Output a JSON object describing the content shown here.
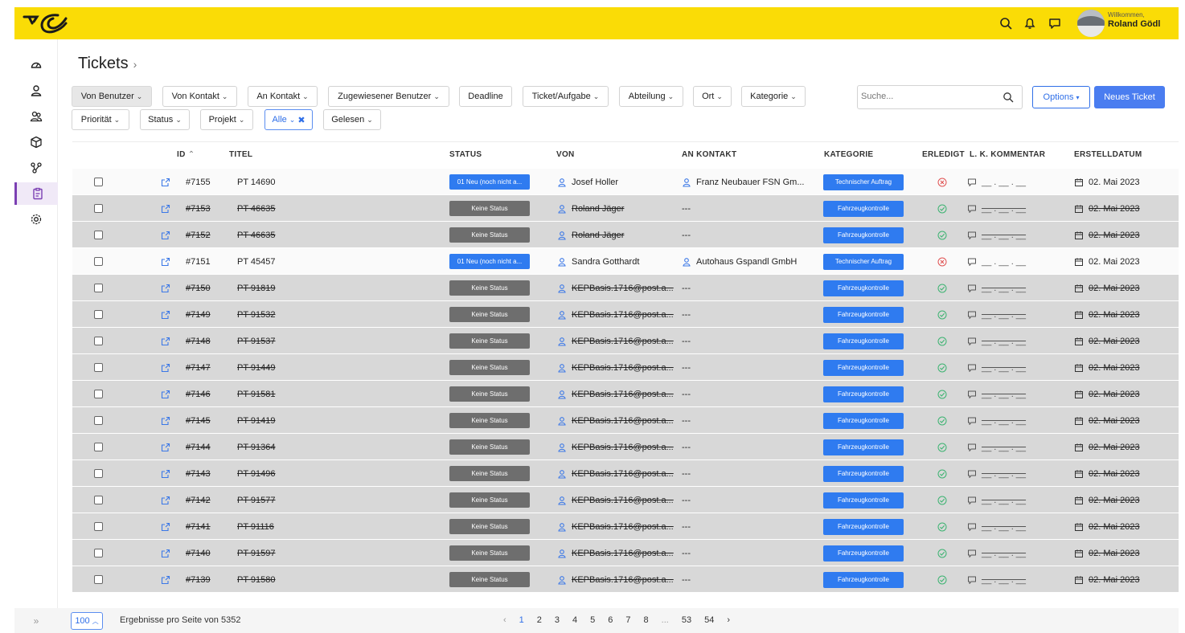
{
  "header": {
    "welcome": "Willkommen,",
    "user_name": "Roland Gödl",
    "brand_color": "#fadc06"
  },
  "page": {
    "title": "Tickets",
    "breadcrumb_chevron": "›"
  },
  "filters": {
    "row1": [
      "Von Benutzer",
      "Von Kontakt",
      "An Kontakt",
      "Zugewiesener Benutzer",
      "Deadline",
      "Ticket/Aufgabe",
      "Abteilung",
      "Ort",
      "Kategorie"
    ],
    "row2": [
      "Priorität",
      "Status",
      "Projekt",
      "Alle",
      "Gelesen"
    ]
  },
  "search": {
    "placeholder": "Suche..."
  },
  "buttons": {
    "options": "Options",
    "new_ticket": "Neues Ticket"
  },
  "columns": {
    "id": "ID",
    "titel": "TITEL",
    "status": "STATUS",
    "von": "VON",
    "an_kontakt": "AN KONTAKT",
    "kategorie": "KATEGORIE",
    "erledigt": "ERLEDIGT",
    "kommentar": "L. K. KOMMENTAR",
    "erstelldatum": "ERSTELLDATUM"
  },
  "tickets": [
    {
      "id": "#7155",
      "titel": "PT 14690",
      "status": "01 Neu (noch nicht a...",
      "von": "Josef Holler",
      "an_kontakt": "Franz Neubauer FSN Gm...",
      "kategorie": "Technischer Auftrag",
      "erledigt": false,
      "kommentar": "__ . __ . __",
      "datum": "02. Mai 2023",
      "closed": false
    },
    {
      "id": "#7153",
      "titel": "PT 46635",
      "status": "Keine Status",
      "von": "Roland Jäger",
      "an_kontakt": "---",
      "kategorie": "Fahrzeugkontrolle",
      "erledigt": true,
      "kommentar": "__ . __ . __",
      "datum": "02. Mai 2023",
      "closed": true
    },
    {
      "id": "#7152",
      "titel": "PT 46635",
      "status": "Keine Status",
      "von": "Roland Jäger",
      "an_kontakt": "---",
      "kategorie": "Fahrzeugkontrolle",
      "erledigt": true,
      "kommentar": "__ . __ . __",
      "datum": "02. Mai 2023",
      "closed": true
    },
    {
      "id": "#7151",
      "titel": "PT 45457",
      "status": "01 Neu (noch nicht a...",
      "von": "Sandra Gotthardt",
      "an_kontakt": "Autohaus Gspandl GmbH",
      "kategorie": "Technischer Auftrag",
      "erledigt": false,
      "kommentar": "__ . __ . __",
      "datum": "02. Mai 2023",
      "closed": false
    },
    {
      "id": "#7150",
      "titel": "PT 91819",
      "status": "Keine Status",
      "von": "KEPBasis.1716@post.a...",
      "an_kontakt": "---",
      "kategorie": "Fahrzeugkontrolle",
      "erledigt": true,
      "kommentar": "__ . __ . __",
      "datum": "02. Mai 2023",
      "closed": true
    },
    {
      "id": "#7149",
      "titel": "PT 91532",
      "status": "Keine Status",
      "von": "KEPBasis.1716@post.a...",
      "an_kontakt": "---",
      "kategorie": "Fahrzeugkontrolle",
      "erledigt": true,
      "kommentar": "__ . __ . __",
      "datum": "02. Mai 2023",
      "closed": true
    },
    {
      "id": "#7148",
      "titel": "PT 91537",
      "status": "Keine Status",
      "von": "KEPBasis.1716@post.a...",
      "an_kontakt": "---",
      "kategorie": "Fahrzeugkontrolle",
      "erledigt": true,
      "kommentar": "__ . __ . __",
      "datum": "02. Mai 2023",
      "closed": true
    },
    {
      "id": "#7147",
      "titel": "PT 91449",
      "status": "Keine Status",
      "von": "KEPBasis.1716@post.a...",
      "an_kontakt": "---",
      "kategorie": "Fahrzeugkontrolle",
      "erledigt": true,
      "kommentar": "__ . __ . __",
      "datum": "02. Mai 2023",
      "closed": true
    },
    {
      "id": "#7146",
      "titel": "PT 91581",
      "status": "Keine Status",
      "von": "KEPBasis.1716@post.a...",
      "an_kontakt": "---",
      "kategorie": "Fahrzeugkontrolle",
      "erledigt": true,
      "kommentar": "__ . __ . __",
      "datum": "02. Mai 2023",
      "closed": true
    },
    {
      "id": "#7145",
      "titel": "PT 91419",
      "status": "Keine Status",
      "von": "KEPBasis.1716@post.a...",
      "an_kontakt": "---",
      "kategorie": "Fahrzeugkontrolle",
      "erledigt": true,
      "kommentar": "__ . __ . __",
      "datum": "02. Mai 2023",
      "closed": true
    },
    {
      "id": "#7144",
      "titel": "PT 91364",
      "status": "Keine Status",
      "von": "KEPBasis.1716@post.a...",
      "an_kontakt": "---",
      "kategorie": "Fahrzeugkontrolle",
      "erledigt": true,
      "kommentar": "__ . __ . __",
      "datum": "02. Mai 2023",
      "closed": true
    },
    {
      "id": "#7143",
      "titel": "PT 91496",
      "status": "Keine Status",
      "von": "KEPBasis.1716@post.a...",
      "an_kontakt": "---",
      "kategorie": "Fahrzeugkontrolle",
      "erledigt": true,
      "kommentar": "__ . __ . __",
      "datum": "02. Mai 2023",
      "closed": true
    },
    {
      "id": "#7142",
      "titel": "PT 91577",
      "status": "Keine Status",
      "von": "KEPBasis.1716@post.a...",
      "an_kontakt": "---",
      "kategorie": "Fahrzeugkontrolle",
      "erledigt": true,
      "kommentar": "__ . __ . __",
      "datum": "02. Mai 2023",
      "closed": true
    },
    {
      "id": "#7141",
      "titel": "PT 91116",
      "status": "Keine Status",
      "von": "KEPBasis.1716@post.a...",
      "an_kontakt": "---",
      "kategorie": "Fahrzeugkontrolle",
      "erledigt": true,
      "kommentar": "__ . __ . __",
      "datum": "02. Mai 2023",
      "closed": true
    },
    {
      "id": "#7140",
      "titel": "PT 91597",
      "status": "Keine Status",
      "von": "KEPBasis.1716@post.a...",
      "an_kontakt": "---",
      "kategorie": "Fahrzeugkontrolle",
      "erledigt": true,
      "kommentar": "__ . __ . __",
      "datum": "02. Mai 2023",
      "closed": true
    },
    {
      "id": "#7139",
      "titel": "PT 91580",
      "status": "Keine Status",
      "von": "KEPBasis.1716@post.a...",
      "an_kontakt": "---",
      "kategorie": "Fahrzeugkontrolle",
      "erledigt": true,
      "kommentar": "__ . __ . __",
      "datum": "02. Mai 2023",
      "closed": true
    }
  ],
  "footer": {
    "per_page": "100",
    "per_page_label": "Ergebnisse pro Seite von 5352",
    "pages": [
      "‹",
      "1",
      "2",
      "3",
      "4",
      "5",
      "6",
      "7",
      "8",
      "...",
      "53",
      "54",
      "›"
    ],
    "current_page": "1"
  },
  "colors": {
    "status_new": "#2f7bf0",
    "status_none": "#6e6e6e",
    "done_ok": "#3cb371",
    "done_open": "#e05252"
  }
}
